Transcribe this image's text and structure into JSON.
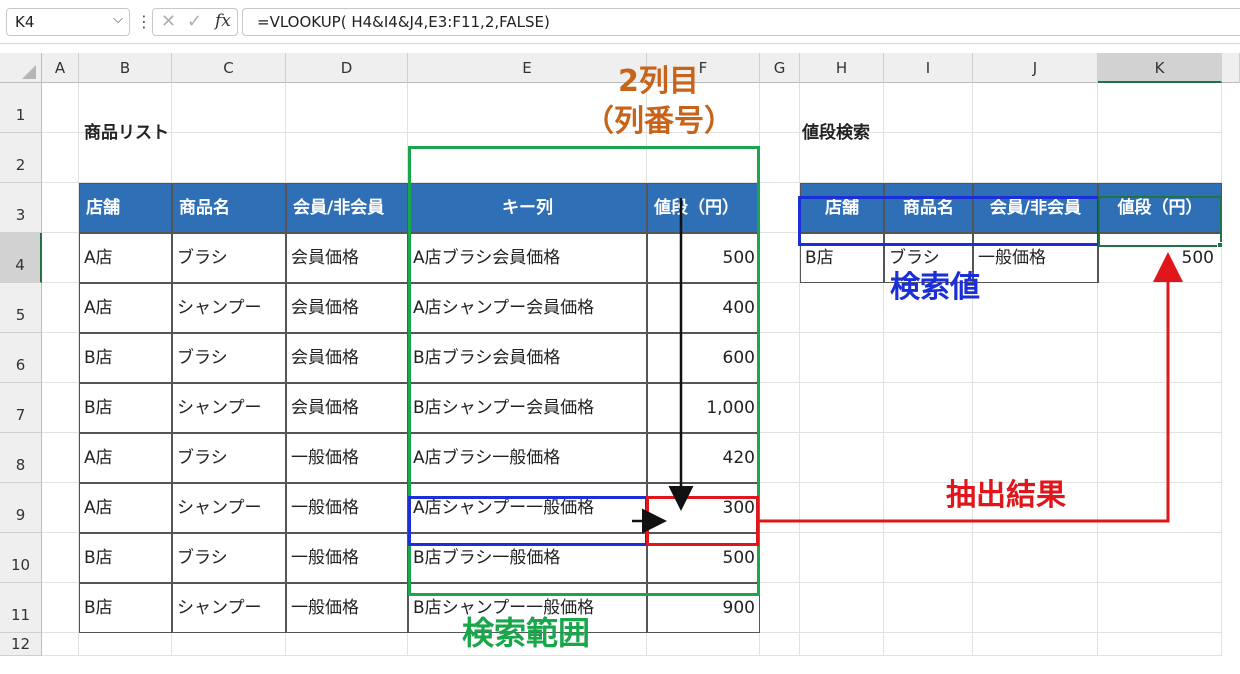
{
  "formula_bar": {
    "name_box": "K4",
    "formula": "=VLOOKUP( H4&I4&J4,E3:F11,2,FALSE)",
    "fx_label": "fx"
  },
  "columns": [
    "A",
    "B",
    "C",
    "D",
    "E",
    "F",
    "G",
    "H",
    "I",
    "J",
    "K"
  ],
  "rows": [
    "1",
    "2",
    "3",
    "4",
    "5",
    "6",
    "7",
    "8",
    "9",
    "10",
    "11",
    "12"
  ],
  "product_list": {
    "title": "商品リスト",
    "headers": [
      "店舗",
      "商品名",
      "会員/非会員",
      "キー列",
      "値段（円）"
    ],
    "rows": [
      [
        "A店",
        "ブラシ",
        "会員価格",
        "A店ブラシ会員価格",
        "500"
      ],
      [
        "A店",
        "シャンプー",
        "会員価格",
        "A店シャンプー会員価格",
        "400"
      ],
      [
        "B店",
        "ブラシ",
        "会員価格",
        "B店ブラシ会員価格",
        "600"
      ],
      [
        "B店",
        "シャンプー",
        "会員価格",
        "B店シャンプー会員価格",
        "1,000"
      ],
      [
        "A店",
        "ブラシ",
        "一般価格",
        "A店ブラシ一般価格",
        "420"
      ],
      [
        "A店",
        "シャンプー",
        "一般価格",
        "A店シャンプー一般価格",
        "300"
      ],
      [
        "B店",
        "ブラシ",
        "一般価格",
        "B店ブラシ一般価格",
        "500"
      ],
      [
        "B店",
        "シャンプー",
        "一般価格",
        "B店シャンプー一般価格",
        "900"
      ]
    ]
  },
  "price_search": {
    "title": "値段検索",
    "headers": [
      "店舗",
      "商品名",
      "会員/非会員",
      "値段（円）"
    ],
    "row": [
      "B店",
      "ブラシ",
      "一般価格",
      "500"
    ]
  },
  "annotations": {
    "col_index_line1": "2列目",
    "col_index_line2": "（列番号）",
    "search_value": "検索値",
    "result": "抽出結果",
    "search_range": "検索範囲",
    "color_search_value": "#1a2fd8",
    "color_result": "#e0161b",
    "color_search_range": "#1aa64a",
    "color_col_index": "#c8631a"
  },
  "colors": {
    "header_fill": "#2e6fb5",
    "selection": "#217346"
  }
}
